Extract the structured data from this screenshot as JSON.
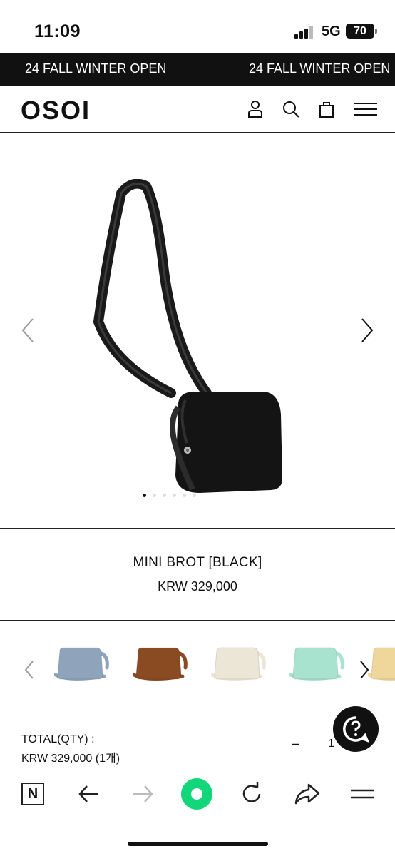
{
  "status_bar": {
    "time": "11:09",
    "network": "5G",
    "battery": "70"
  },
  "banner": {
    "text_1": "24 FALL WINTER OPEN",
    "text_2": "24 FALL WINTER OPEN"
  },
  "header": {
    "logo": "OSOI"
  },
  "product": {
    "name": "MINI BROT [BLACK]",
    "price": "KRW   329,000"
  },
  "gallery": {
    "total_dots": 6,
    "active_dot": 1
  },
  "swatches": [
    {
      "color": "#8fa4bb"
    },
    {
      "color": "#8b4b22"
    },
    {
      "color": "#ece6d6"
    },
    {
      "color": "#a8e3cf"
    },
    {
      "color": "#efd79b"
    }
  ],
  "total": {
    "label": "TOTAL(QTY) :",
    "value": "KRW 329,000 (1개)",
    "qty_minus": "–",
    "qty": "1"
  },
  "toolbar": {
    "n_label": "N"
  }
}
